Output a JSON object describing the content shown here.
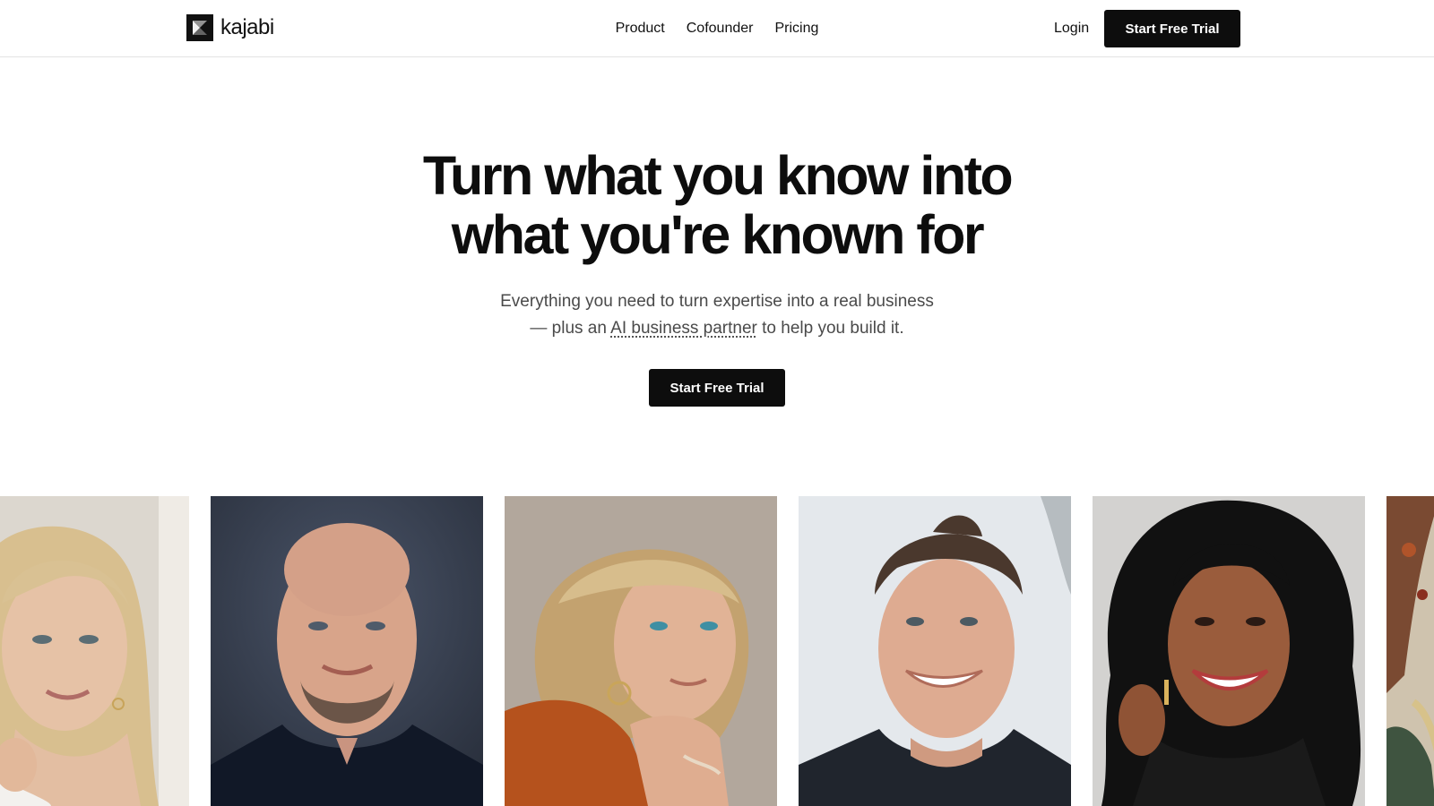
{
  "brand": {
    "name": "kajabi",
    "logo_icon": "kajabi-logo-icon",
    "accent": "#0d0d0d"
  },
  "nav": {
    "items": [
      {
        "label": "Product"
      },
      {
        "label": "Cofounder"
      },
      {
        "label": "Pricing"
      }
    ],
    "login_label": "Login",
    "cta_label": "Start Free Trial"
  },
  "hero": {
    "title_line1": "Turn what you know into",
    "title_line2": "what you're known for",
    "subtitle_line1": "Everything you need to turn expertise into a real business",
    "subtitle_prefix": "— plus an ",
    "subtitle_link": "AI business partner",
    "subtitle_suffix": " to help you build it.",
    "cta_label": "Start Free Trial"
  },
  "portraits": [
    {
      "name": "portrait-blonde-woman",
      "bg": "#d9d4cc"
    },
    {
      "name": "portrait-bald-man",
      "bg": "#3b4556"
    },
    {
      "name": "portrait-older-woman",
      "bg": "#b3a89d"
    },
    {
      "name": "portrait-smiling-man",
      "bg": "#e6e9ec"
    },
    {
      "name": "portrait-curly-hair-woman",
      "bg": "#d0cfcd"
    },
    {
      "name": "portrait-partial-right",
      "bg": "#8a6a52"
    }
  ]
}
